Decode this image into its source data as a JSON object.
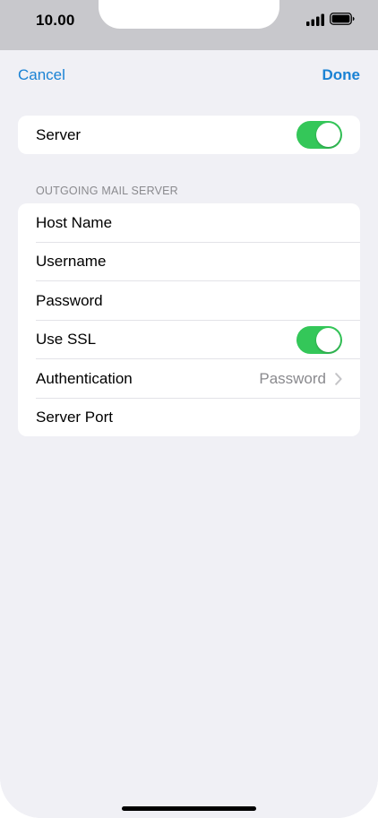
{
  "status_bar": {
    "time": "10.00",
    "icons": [
      "signal-icon",
      "battery-icon"
    ]
  },
  "nav": {
    "cancel_label": "Cancel",
    "done_label": "Done"
  },
  "server_section": {
    "server_label": "Server",
    "server_enabled": true
  },
  "outgoing": {
    "header": "OUTGOING MAIL SERVER",
    "host_name_label": "Host Name",
    "username_label": "Username",
    "password_label": "Password",
    "use_ssl_label": "Use SSL",
    "use_ssl_enabled": true,
    "authentication_label": "Authentication",
    "authentication_value": "Password",
    "server_port_label": "Server Port"
  },
  "colors": {
    "accent": "#1a82d4",
    "toggle_on": "#34c759",
    "background": "#f0f0f5",
    "secondary_text": "#8a8a8e"
  }
}
